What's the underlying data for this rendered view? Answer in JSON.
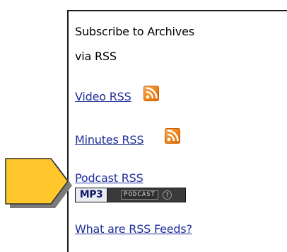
{
  "panel": {
    "heading_line1": "Subscribe to Archives",
    "heading_line2": "via RSS",
    "links": {
      "video": "Video RSS",
      "minutes": "Minutes RSS",
      "podcast": "Podcast RSS",
      "what_are": "What are RSS Feeds?"
    },
    "mp3_badge": {
      "left_text": "MP3",
      "right_text": "PODCAST",
      "circle_text": "?"
    }
  },
  "icons": {
    "rss": "rss-feed-icon",
    "arrow": "yellow-pointer-arrow"
  },
  "colors": {
    "link": "#1e2d98",
    "rss_orange": "#f08a1c",
    "arrow_yellow": "#ffc72c"
  }
}
